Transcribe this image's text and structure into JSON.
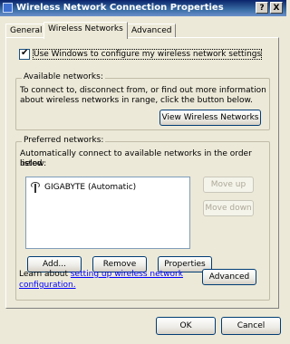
{
  "window": {
    "title": "Wireless Network Connection Properties",
    "help_button": "?",
    "close_button": "X"
  },
  "tabs": [
    {
      "label": "General"
    },
    {
      "label": "Wireless Networks"
    },
    {
      "label": "Advanced"
    }
  ],
  "use_windows": {
    "label": "Use Windows to configure my wireless network settings",
    "checked": true
  },
  "available": {
    "legend": "Available networks:",
    "description_line1": "To connect to, disconnect from, or find out more information",
    "description_line2": "about wireless networks in range, click the button below.",
    "view_button": "View Wireless Networks"
  },
  "preferred": {
    "legend": "Preferred networks:",
    "description_line1": "Automatically connect to available networks in the order listed",
    "description_line2": "below:",
    "networks": [
      {
        "name": "GIGABYTE (Automatic)"
      }
    ],
    "move_up_button": "Move up",
    "move_down_button": "Move down",
    "add_button": "Add...",
    "remove_button": "Remove",
    "properties_button": "Properties"
  },
  "learn": {
    "prefix": "Learn about",
    "link_line1": "setting up wireless network",
    "link_line2": "configuration.",
    "advanced_button": "Advanced"
  },
  "footer": {
    "ok_button": "OK",
    "cancel_button": "Cancel"
  },
  "colors": {
    "titlebar": "#0a246a",
    "dialog_bg": "#ece9d8",
    "link": "#0000ff"
  }
}
